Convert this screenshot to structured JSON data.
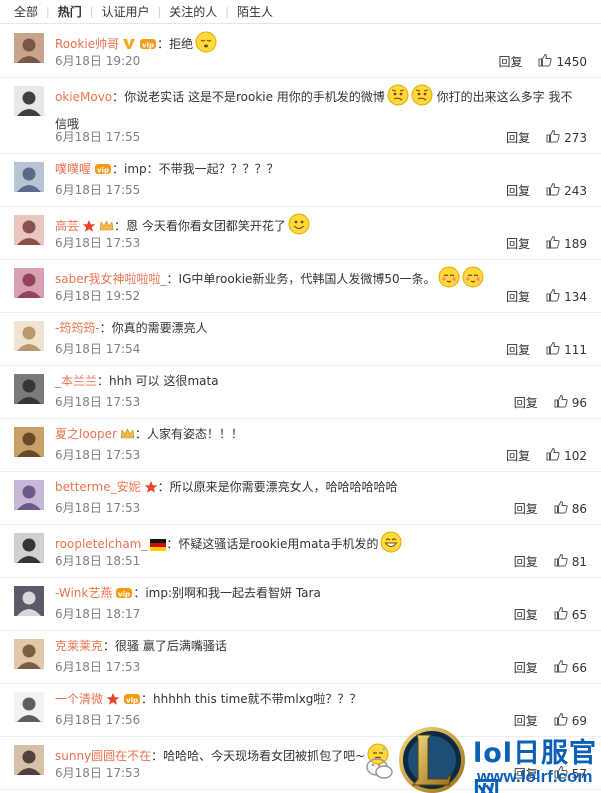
{
  "tabs": [
    "全部",
    "热门",
    "认证用户",
    "关注的人",
    "陌生人"
  ],
  "reply_label": "回复",
  "comments": [
    {
      "user": "Rookie帅哥",
      "badges": [
        "v-icon",
        "vip-icon"
      ],
      "text": "：拒绝",
      "emoji": [
        "sleepy-emoji"
      ],
      "date": "6月18日 19:20",
      "likes": "1450"
    },
    {
      "user": "okieMovo",
      "badges": [],
      "text": "：你说老实话  这是不是rookie 用你的手机发的微博",
      "text2": " 你打的出来这么多字 我不信哦",
      "emoji": [
        "doubt-emoji",
        "doubt-emoji"
      ],
      "date": "6月18日 17:55",
      "likes": "273"
    },
    {
      "user": "噗噗喔",
      "badges": [
        "vip-icon"
      ],
      "text": "：imp：不带我一起？？？？？",
      "emoji": [],
      "date": "6月18日 17:55",
      "likes": "243"
    },
    {
      "user": "高芸",
      "badges": [
        "star-icon",
        "crown-icon"
      ],
      "text": "：恩 今天看你看女团都笑开花了",
      "emoji": [
        "smile-emoji"
      ],
      "date": "6月18日 17:53",
      "likes": "189"
    },
    {
      "user": "saber我女神啦啦啦_",
      "badges": [],
      "text": "：IG中单rookie新业务，代韩国人发微博50一条。",
      "emoji": [
        "shy-emoji",
        "shy-emoji"
      ],
      "date": "6月18日 19:52",
      "likes": "134"
    },
    {
      "user": "-筠筠筠-",
      "badges": [],
      "text": "：你真的需要漂亮人",
      "emoji": [],
      "date": "6月18日 17:54",
      "likes": "111"
    },
    {
      "user": "_本兰兰",
      "badges": [],
      "text": "：hhh 可以 这很mata",
      "emoji": [],
      "date": "6月18日 17:53",
      "likes": "96"
    },
    {
      "user": "夏之looper",
      "badges": [
        "crown-icon"
      ],
      "text": "：人家有姿态！！！",
      "emoji": [],
      "date": "6月18日 17:53",
      "likes": "102"
    },
    {
      "user": "betterme_安妮",
      "badges": [
        "star-icon"
      ],
      "text": "：所以原来是你需要漂亮女人，哈哈哈哈哈哈",
      "emoji": [],
      "date": "6月18日 17:53",
      "likes": "86"
    },
    {
      "user": "roopletelcham_",
      "badges": [
        "flag-icon"
      ],
      "text": "：怀疑这骚话是rookie用mata手机发的",
      "emoji": [
        "grin-emoji"
      ],
      "date": "6月18日 18:51",
      "likes": "81"
    },
    {
      "user": "-Wink艺燕",
      "badges": [
        "vip-icon"
      ],
      "text": "：imp:别啊和我一起去看智妍 Tara",
      "emoji": [],
      "date": "6月18日 18:17",
      "likes": "65"
    },
    {
      "user": "克莱莱克",
      "badges": [],
      "text": "：很骚 赢了后满嘴骚话",
      "emoji": [],
      "date": "6月18日 17:53",
      "likes": "66"
    },
    {
      "user": "一个清微",
      "badges": [
        "star-icon",
        "vip-icon"
      ],
      "text": "：hhhhh this time就不带mlxg啦？？？",
      "emoji": [],
      "date": "6月18日 17:56",
      "likes": "69"
    },
    {
      "user": "sunny圆圆在不在",
      "badges": [],
      "text": "：哈哈哈、今天现场看女团被抓包了吧~",
      "emoji": [
        "sweat-emoji"
      ],
      "date": "6月18日 17:53",
      "likes": "57"
    }
  ],
  "watermark": {
    "title": "lol日服官网",
    "url": "www.lolrf.com"
  },
  "colors": {
    "username": "#eb7350",
    "text": "#333333",
    "date": "#808080",
    "divider": "#eeeeee",
    "watermark": "#0b5fb7"
  }
}
